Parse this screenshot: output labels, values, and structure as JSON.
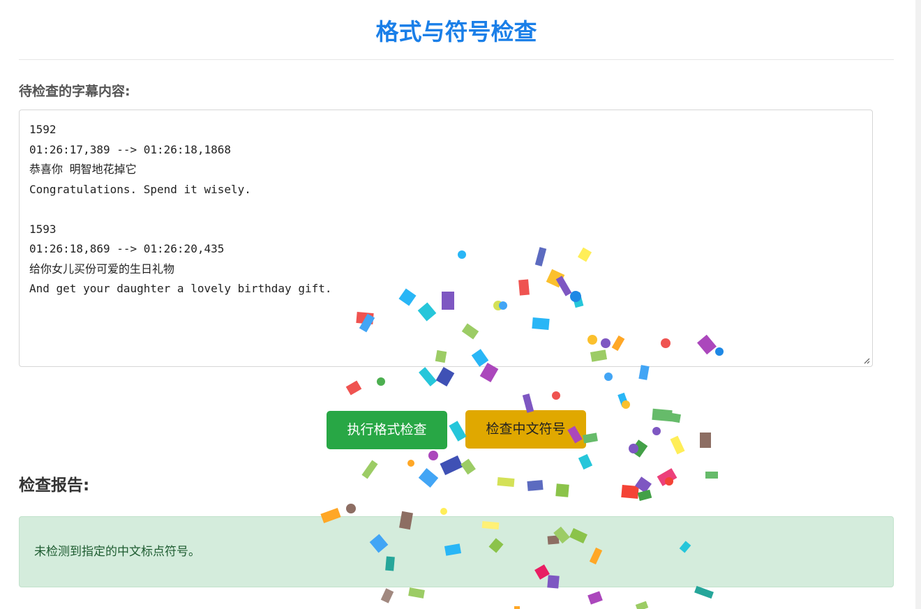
{
  "page": {
    "title": "格式与符号检查",
    "input_label": "待检查的字幕内容:",
    "subtitle_content": "1592\n01:26:17,389 --> 01:26:18,1868\n恭喜你 明智地花掉它\nCongratulations. Spend it wisely.\n\n1593\n01:26:18,869 --> 01:26:20,435\n给你女儿买份可爱的生日礼物\nAnd get your daughter a lovely birthday gift."
  },
  "actions": {
    "format_check_label": "执行格式检查",
    "chinese_punct_label": "检查中文符号"
  },
  "report": {
    "heading": "检查报告:",
    "message": "未检测到指定的中文标点符号。"
  },
  "colors": {
    "title": "#1a7fe8",
    "format_button": "#28a745",
    "punct_button": "#e0a800",
    "report_background": "#d4ecdc",
    "report_text": "#1e5c31"
  },
  "icons": {
    "resize_grip": "resize-grip-icon"
  }
}
